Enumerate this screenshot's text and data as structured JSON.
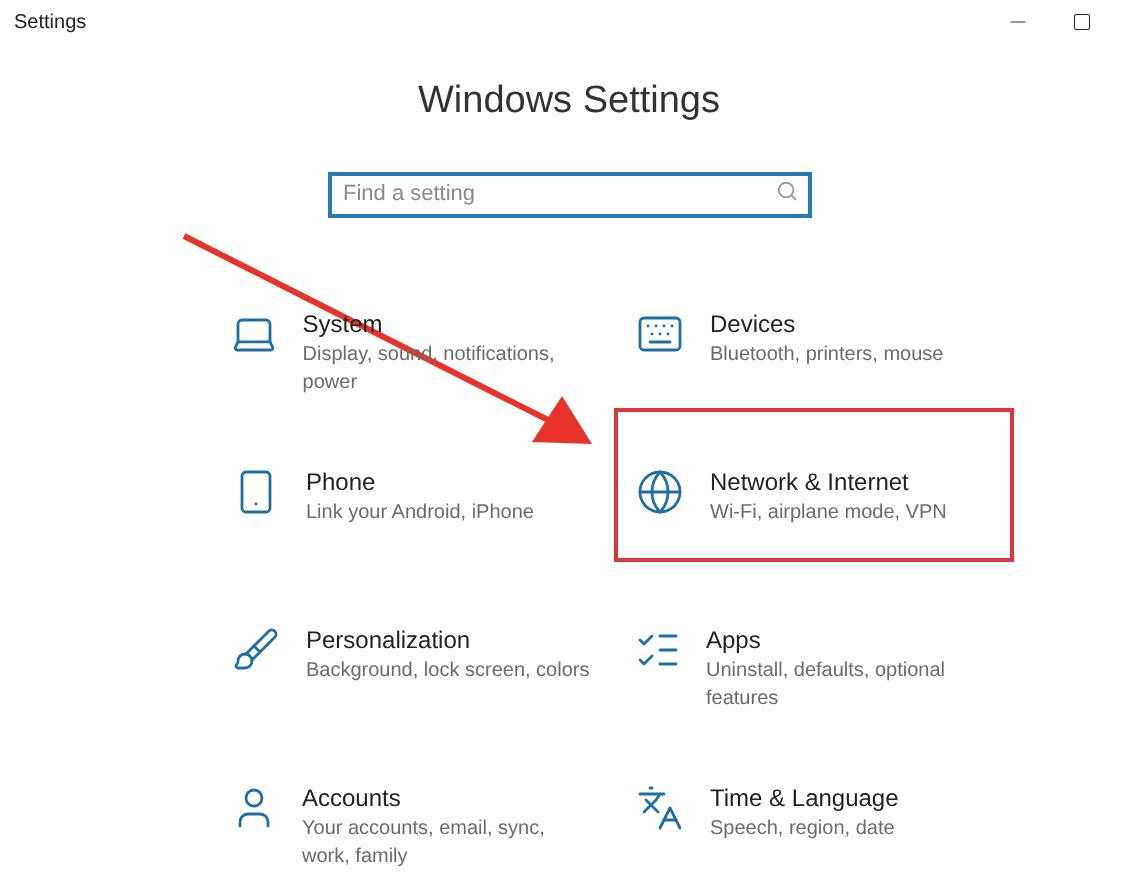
{
  "window": {
    "title": "Settings"
  },
  "heading": "Windows Settings",
  "search": {
    "placeholder": "Find a setting"
  },
  "tiles": [
    {
      "kind": "system",
      "title": "System",
      "subtitle": "Display, sound, notifications, power",
      "highlighted": false
    },
    {
      "kind": "devices",
      "title": "Devices",
      "subtitle": "Bluetooth, printers, mouse",
      "highlighted": false
    },
    {
      "kind": "phone",
      "title": "Phone",
      "subtitle": "Link your Android, iPhone",
      "highlighted": false
    },
    {
      "kind": "network",
      "title": "Network & Internet",
      "subtitle": "Wi-Fi, airplane mode, VPN",
      "highlighted": true
    },
    {
      "kind": "personalization",
      "title": "Personalization",
      "subtitle": "Background, lock screen, colors",
      "highlighted": false
    },
    {
      "kind": "apps",
      "title": "Apps",
      "subtitle": "Uninstall, defaults, optional features",
      "highlighted": false
    },
    {
      "kind": "accounts",
      "title": "Accounts",
      "subtitle": "Your accounts, email, sync, work, family",
      "highlighted": false
    },
    {
      "kind": "time",
      "title": "Time & Language",
      "subtitle": "Speech, region, date",
      "highlighted": false
    }
  ]
}
